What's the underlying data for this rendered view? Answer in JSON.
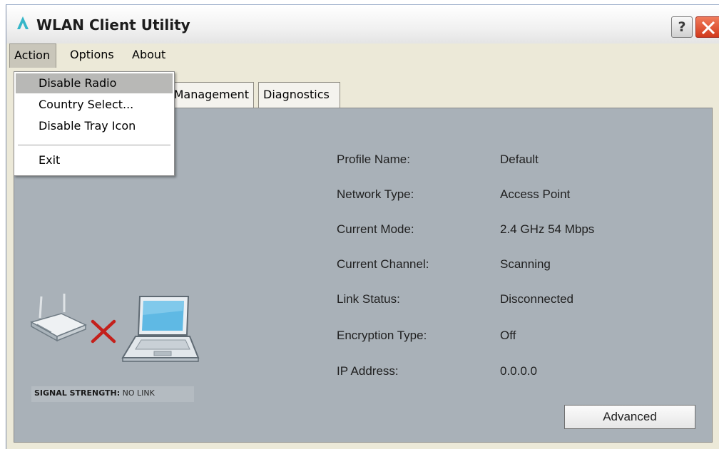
{
  "window": {
    "title": "WLAN Client Utility",
    "help_label": "?"
  },
  "menubar": {
    "items": [
      "Action",
      "Options",
      "About"
    ]
  },
  "action_menu": {
    "items": [
      "Disable Radio",
      "Country Select...",
      "Disable Tray Icon",
      "Exit"
    ],
    "highlighted": "Disable Radio"
  },
  "tabs": [
    "Management",
    "Diagnostics"
  ],
  "status": {
    "rows": [
      {
        "label": "Profile Name:",
        "value": "Default"
      },
      {
        "label": "Network Type:",
        "value": "Access Point"
      },
      {
        "label": "Current Mode:",
        "value": "2.4 GHz 54 Mbps"
      },
      {
        "label": "Current Channel:",
        "value": "Scanning"
      },
      {
        "label": "Link Status:",
        "value": "Disconnected"
      },
      {
        "label": "Encryption Type:",
        "value": "Off"
      },
      {
        "label": "IP Address:",
        "value": "0.0.0.0"
      }
    ],
    "advanced_label": "Advanced"
  },
  "signal": {
    "label": "SIGNAL STRENGTH:",
    "value": "NO LINK"
  },
  "icons": [
    "app-logo-icon",
    "help-icon",
    "close-icon",
    "router-icon",
    "x-mark-icon",
    "laptop-icon"
  ],
  "colors": {
    "panel_bg": "#a9b1b8",
    "close_red": "#d23a1c",
    "x_mark_red": "#c4201b",
    "menu_highlight": "#b8b8b6"
  }
}
